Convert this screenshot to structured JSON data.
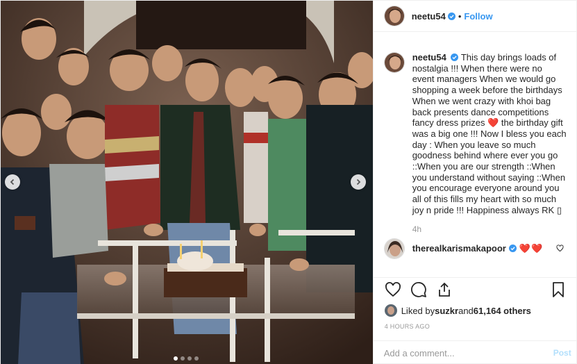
{
  "colors": {
    "accent": "#3897f0",
    "muted": "#999999",
    "heart": "#ed4956",
    "post_disabled": "#b2dffc"
  },
  "header": {
    "username": "neetu54",
    "separator": "•",
    "follow_label": "Follow",
    "verified_icon": "verified-badge-icon"
  },
  "caption": {
    "username": "neetu54",
    "text_part1": "This day brings loads of nostalgia !!! When there were no event managers When we would go shopping a week before the birthdays When we went crazy with khoi bag back presents dance competitions fancy dress prizes ",
    "emoji1": "❤️",
    "text_part2": " the birthday gift was a big one !!! Now I bless you each day : When you leave so much goodness behind where ever you go ::When you are our strength ::When you understand without saying ::When you encourage everyone around you all of this fills my heart with so much joy n pride !!! Happiness always RK ",
    "emoji2": "▯",
    "time": "4h"
  },
  "comments": [
    {
      "username": "therealkarismakapoor",
      "hearts": [
        "❤️",
        "❤️"
      ]
    }
  ],
  "actions": {
    "icons": [
      "heart-icon",
      "comment-icon",
      "share-icon",
      "save-icon"
    ]
  },
  "likes": {
    "prefix": "Liked by ",
    "user": "suzkr",
    "middle": " and ",
    "count": "61,164 others"
  },
  "date": "4 HOURS AGO",
  "add_comment": {
    "placeholder": "Add a comment...",
    "post_label": "Post"
  },
  "carousel": {
    "slides": 4,
    "active_slide": 1
  }
}
